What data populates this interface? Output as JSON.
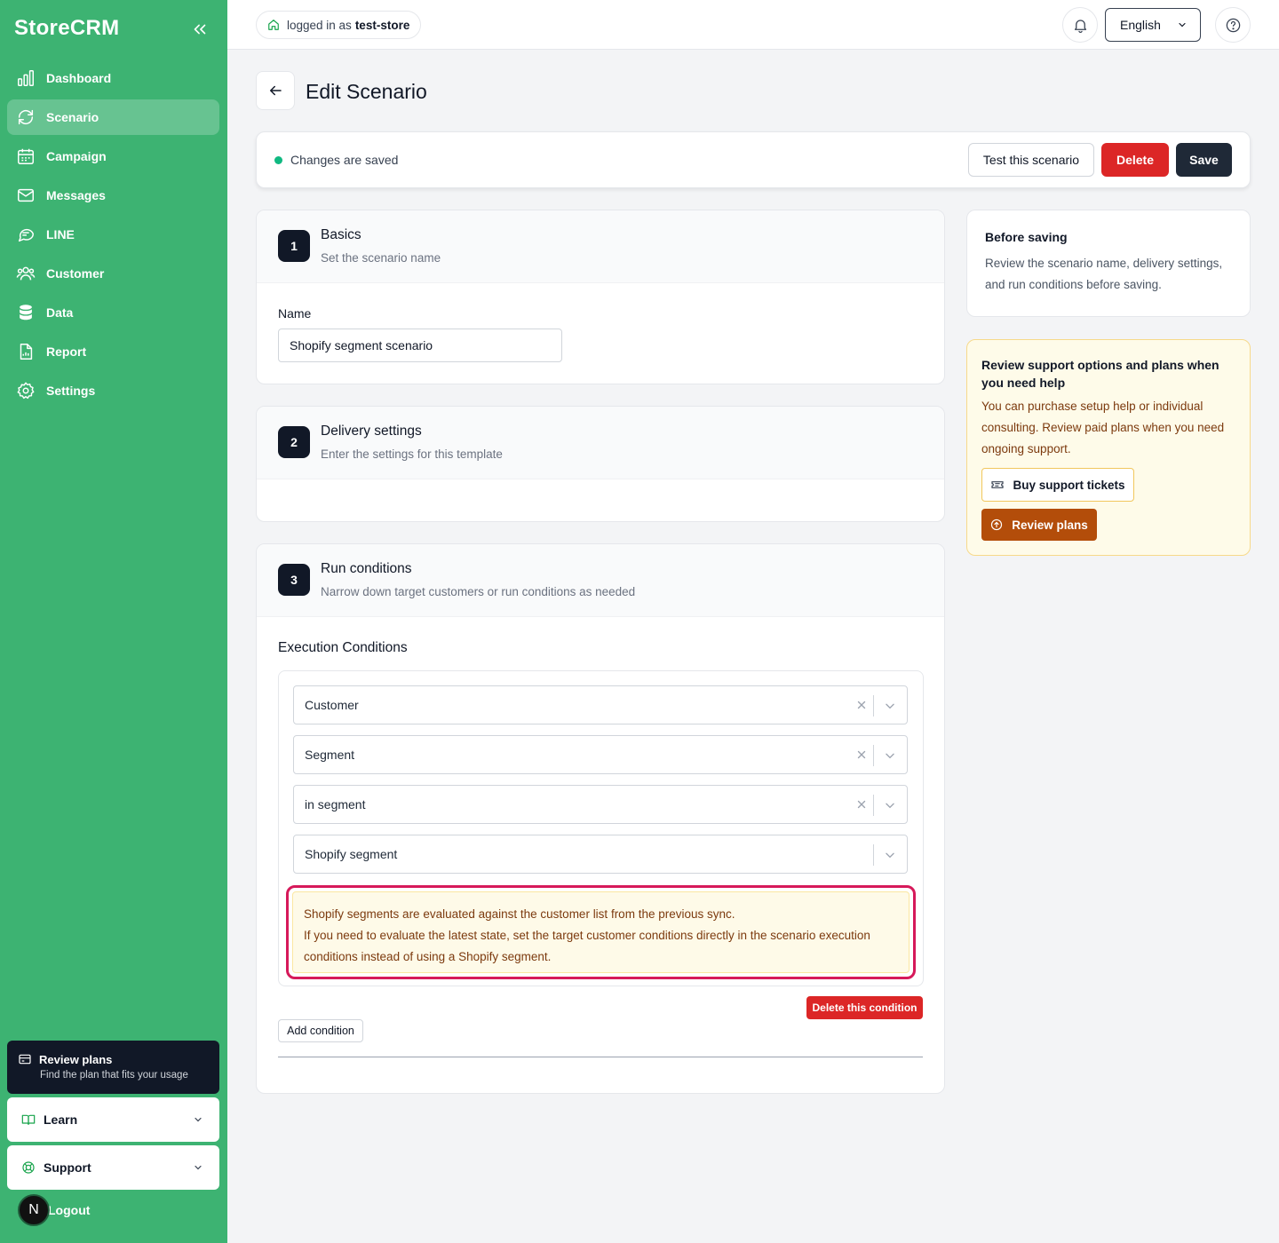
{
  "app": {
    "brand": "StoreCRM"
  },
  "sidebar": {
    "items": [
      {
        "label": "Dashboard",
        "icon": "bar-chart-icon"
      },
      {
        "label": "Scenario",
        "icon": "refresh-icon"
      },
      {
        "label": "Campaign",
        "icon": "calendar-icon"
      },
      {
        "label": "Messages",
        "icon": "mail-icon"
      },
      {
        "label": "LINE",
        "icon": "chat-icon"
      },
      {
        "label": "Customer",
        "icon": "users-icon"
      },
      {
        "label": "Data",
        "icon": "database-icon"
      },
      {
        "label": "Report",
        "icon": "report-icon"
      },
      {
        "label": "Settings",
        "icon": "gear-icon"
      }
    ],
    "active": "Scenario",
    "plan_card": {
      "title": "Review plans",
      "subtitle": "Find the plan that fits your usage"
    },
    "learn_label": "Learn",
    "support_label": "Support",
    "logout_label": "Logout",
    "avatar_initial": "N"
  },
  "header": {
    "logged_in_prefix": "logged in as",
    "store_name": "test-store",
    "language": "English"
  },
  "page": {
    "title": "Edit Scenario",
    "status": "Changes are saved",
    "test_button": "Test this scenario",
    "delete_button": "Delete",
    "save_button": "Save"
  },
  "basics": {
    "step": "1",
    "title": "Basics",
    "subtitle": "Set the scenario name",
    "name_label": "Name",
    "name_value": "Shopify segment scenario"
  },
  "delivery": {
    "step": "2",
    "title": "Delivery settings",
    "subtitle": "Enter the settings for this template"
  },
  "run": {
    "step": "3",
    "title": "Run conditions",
    "subtitle": "Narrow down target customers or run conditions as needed",
    "exec_label": "Execution Conditions",
    "selects": [
      "Customer",
      "Segment",
      "in segment",
      "Shopify segment"
    ],
    "warning_line1": "Shopify segments are evaluated against the customer list from the previous sync.",
    "warning_line2": "If you need to evaluate the latest state, set the target customer conditions directly in the scenario execution conditions instead of using a Shopify segment.",
    "delete_condition": "Delete this condition",
    "add_condition": "Add condition"
  },
  "before_saving": {
    "title": "Before saving",
    "text": "Review the scenario name, delivery settings, and run conditions before saving."
  },
  "support": {
    "title": "Review support options and plans when you need help",
    "text": "You can purchase setup help or individual consulting. Review paid plans when you need ongoing support.",
    "tickets_button": "Buy support tickets",
    "plans_button": "Review plans"
  },
  "colors": {
    "sidebar": "#3db372",
    "danger": "#dc2626",
    "dark": "#1f2937",
    "warning_outline": "#d6195a",
    "plans_button": "#b34d0a"
  }
}
